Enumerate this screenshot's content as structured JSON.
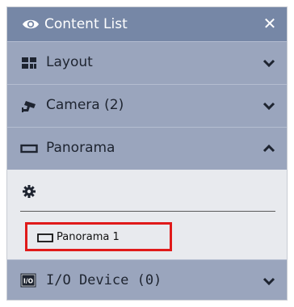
{
  "window": {
    "title": "Content List",
    "close_glyph": "✕"
  },
  "sections": {
    "layout": {
      "label": "Layout",
      "icon": "layout-grid-icon",
      "expanded": false
    },
    "camera": {
      "label": "Camera (2)",
      "icon": "camera-icon",
      "expanded": false
    },
    "panorama": {
      "label": "Panorama",
      "icon": "panorama-icon",
      "expanded": true
    },
    "io_device": {
      "label": "I/O Device (0)",
      "icon": "io-device-icon",
      "expanded": false
    }
  },
  "panorama_list": {
    "settings_icon": "gear-icon",
    "items": [
      {
        "label": "Panorama 1",
        "icon": "panorama-icon",
        "highlighted": true
      }
    ]
  },
  "colors": {
    "titlebar": "#7687a6",
    "section": "#9aa5bd",
    "body": "#e8eaee",
    "highlight": "#e01a1a"
  }
}
